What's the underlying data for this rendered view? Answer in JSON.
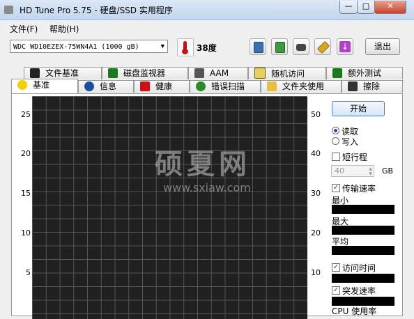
{
  "window": {
    "title": "HD Tune Pro 5.75 - 硬盘/SSD 实用程序",
    "minimize": "—",
    "maximize": "□",
    "close": "✕"
  },
  "menu": [
    {
      "label": "文件(F)"
    },
    {
      "label": "帮助(H)"
    }
  ],
  "toolbar": {
    "drive": "WDC WD10EZEX-75WN4A1 (1000 gB)",
    "temperature": "38度",
    "buttons": [
      "copy-icon",
      "copy-info-icon",
      "camera-icon",
      "tools-icon",
      "download-icon"
    ],
    "exit_label": "退出"
  },
  "tabs_row1": [
    {
      "label": "文件基准",
      "icon": "file-benchmark-icon"
    },
    {
      "label": "磁盘监视器",
      "icon": "disk-monitor-icon"
    },
    {
      "label": "AAM",
      "icon": "speaker-icon"
    },
    {
      "label": "随机访问",
      "icon": "random-access-icon"
    },
    {
      "label": "额外测试",
      "icon": "extra-tests-icon"
    }
  ],
  "tabs_row2": [
    {
      "label": "基准",
      "icon": "lightbulb-icon",
      "active": true
    },
    {
      "label": "信息",
      "icon": "info-icon"
    },
    {
      "label": "健康",
      "icon": "health-cross-icon"
    },
    {
      "label": "错误扫描",
      "icon": "magnifier-icon"
    },
    {
      "label": "文件夹使用",
      "icon": "folder-icon"
    },
    {
      "label": "擦除",
      "icon": "trash-icon"
    }
  ],
  "chart": {
    "left_ticks": [
      "25",
      "20",
      "15",
      "10",
      "5"
    ],
    "right_ticks": [
      "50",
      "40",
      "30",
      "20",
      "10"
    ],
    "watermark": "硕夏网",
    "watermark_url": "www.sxiaw.com"
  },
  "controls": {
    "start": "开始",
    "read": "读取",
    "write": "写入",
    "read_selected": true,
    "short_stroke": "短行程",
    "short_stroke_checked": false,
    "gb_value": "40",
    "gb_unit": "GB",
    "transfer_rate": "传输速率",
    "transfer_rate_checked": true,
    "min": "最小",
    "max": "最大",
    "avg": "平均",
    "access_time": "访问时间",
    "access_time_checked": true,
    "burst_rate": "突发速率",
    "burst_rate_checked": true,
    "cpu_usage": "CPU 使用率"
  }
}
